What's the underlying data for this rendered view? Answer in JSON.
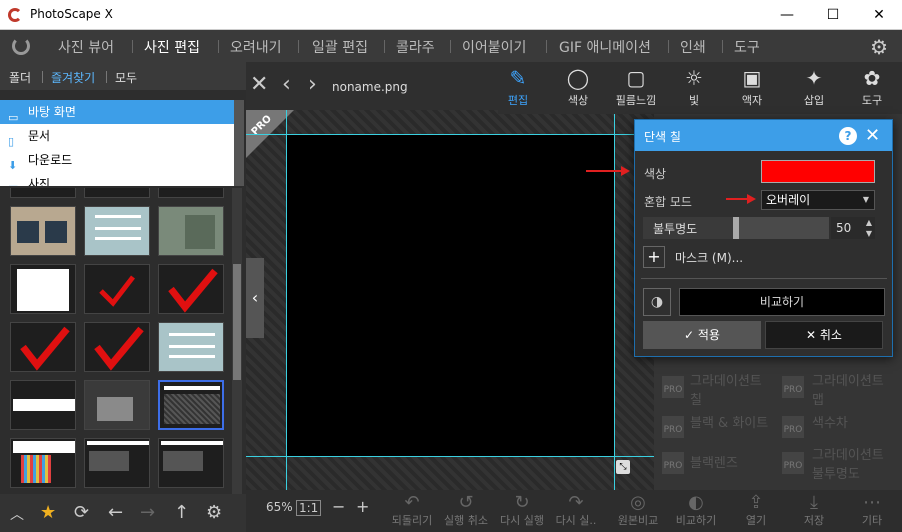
{
  "window": {
    "title": "PhotoScape X",
    "minimize_glyph": "—",
    "maximize_glyph": "☐",
    "close_glyph": "✕"
  },
  "menu": {
    "items": [
      "사진 뷰어",
      "사진 편집",
      "오려내기",
      "일괄 편집",
      "콜라주",
      "이어붙이기",
      "GIF 애니메이션",
      "인쇄",
      "도구"
    ],
    "active": "사진 편집"
  },
  "left": {
    "tabs": [
      "폴더",
      "즐겨찾기",
      "모두"
    ],
    "active_tab": "즐겨찾기",
    "folders": [
      {
        "label": "바탕 화면",
        "icon": "desktop-icon",
        "glyph": "▭"
      },
      {
        "label": "문서",
        "icon": "document-icon",
        "glyph": "▯"
      },
      {
        "label": "다운로드",
        "icon": "download-icon",
        "glyph": "⬇"
      },
      {
        "label": "사진",
        "icon": "pictures-icon",
        "glyph": "▣"
      }
    ],
    "selected_folder": "바탕 화면"
  },
  "canvas": {
    "filename": "noname.png",
    "pro_badge": "PRO"
  },
  "tools": [
    {
      "label": "편집",
      "icon": "edit-icon",
      "glyph": "✎",
      "active": true
    },
    {
      "label": "색상",
      "icon": "color-icon",
      "glyph": "◯",
      "active": false
    },
    {
      "label": "필름느낌",
      "icon": "film-icon",
      "glyph": "▢",
      "active": false
    },
    {
      "label": "빛",
      "icon": "light-icon",
      "glyph": "☼",
      "active": false
    },
    {
      "label": "액자",
      "icon": "frame-icon",
      "glyph": "▣",
      "active": false
    },
    {
      "label": "삽입",
      "icon": "insert-icon",
      "glyph": "✦",
      "active": false
    },
    {
      "label": "도구",
      "icon": "tools-icon",
      "glyph": "✿",
      "active": false
    }
  ],
  "right_items": [
    {
      "label": "그라데이션트 칠"
    },
    {
      "label": "그라데이션트 맵"
    },
    {
      "label": "블랙 & 화이트"
    },
    {
      "label": "색수차"
    },
    {
      "label": "블랙렌즈"
    },
    {
      "label": "그라데이션트 불투명도"
    }
  ],
  "dialog": {
    "title": "단색 칠",
    "color_label": "색상",
    "color_value": "#ff0000",
    "blend_label": "혼합 모드",
    "blend_value": "오버레이",
    "opacity_label": "불투명도",
    "opacity_value": "50",
    "mask_label": "마스크 (M)...",
    "compare_label": "비교하기",
    "apply_label": "적용",
    "cancel_label": "취소"
  },
  "bottom": {
    "zoom": "65%",
    "one_to_one": "1:1",
    "actions": [
      "되돌리기",
      "실행 취소",
      "다시 실행",
      "다시 실..",
      "원본비교",
      "비교하기",
      "열기",
      "저장",
      "기타"
    ]
  }
}
